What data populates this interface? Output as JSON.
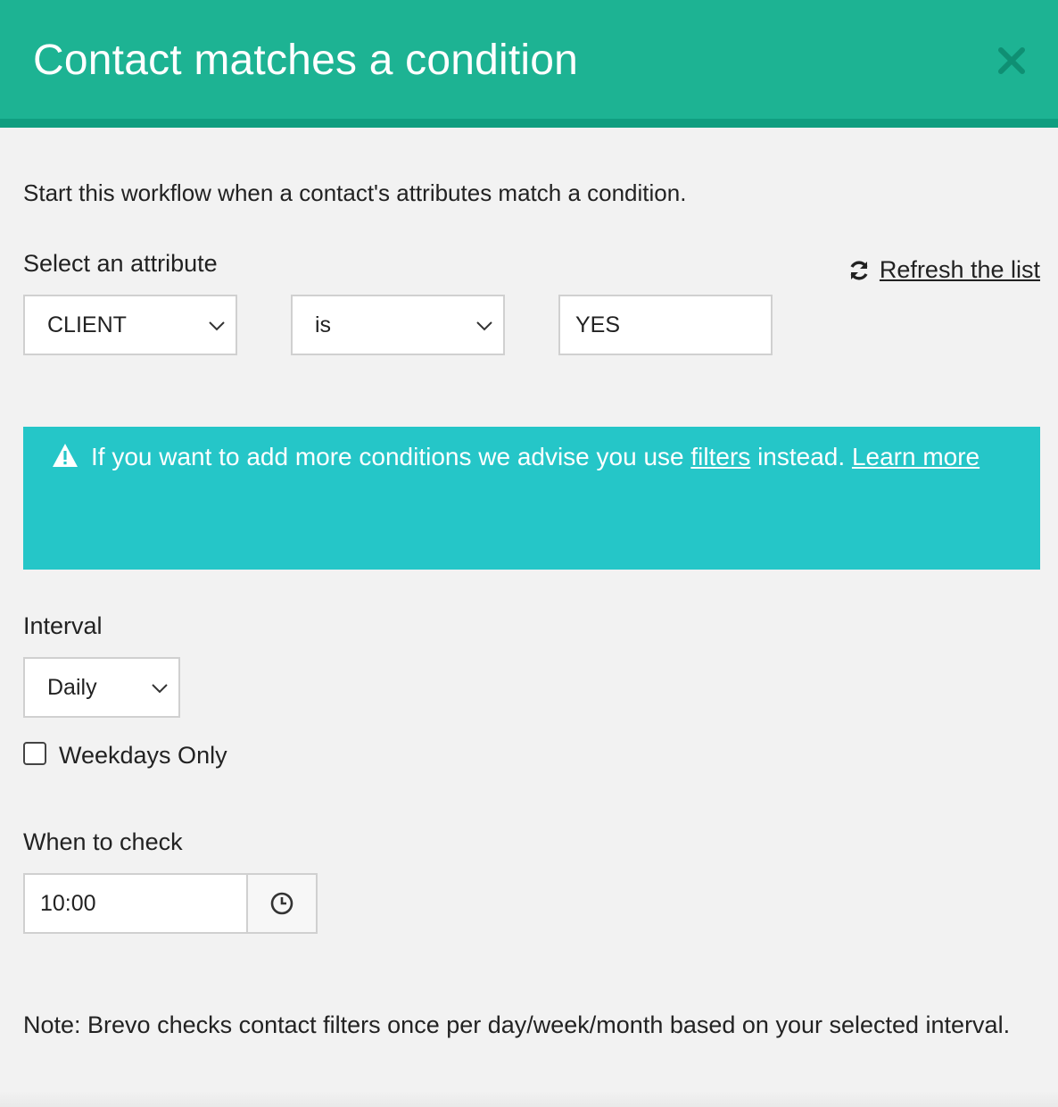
{
  "modal": {
    "title": "Contact matches a condition",
    "close_icon": "close-icon",
    "intro": "Start this workflow when a contact's attributes match a condition."
  },
  "attribute": {
    "label": "Select an attribute",
    "refresh_label": " Refresh the list",
    "refresh_icon": "refresh-icon",
    "attribute_value": "CLIENT",
    "operator_value": "is",
    "value_field": "YES"
  },
  "notice": {
    "text_before": "If you want to add more conditions we advise you use ",
    "filters_link": "filters",
    "text_middle": " instead. ",
    "learn_more_link": "Learn more",
    "icon": "warning-icon"
  },
  "interval": {
    "label": "Interval",
    "value": "Daily",
    "weekdays_only_label": "Weekdays Only",
    "weekdays_only_checked": false
  },
  "when_to_check": {
    "label": "When to check",
    "time_value": "10:00",
    "icon": "clock-icon"
  },
  "note": "Note: Brevo checks contact filters once per day/week/month based on your selected interval.",
  "colors": {
    "header": "#1db393",
    "header_border": "#109e80",
    "notice": "#25c6c8",
    "background": "#f2f2f2"
  }
}
